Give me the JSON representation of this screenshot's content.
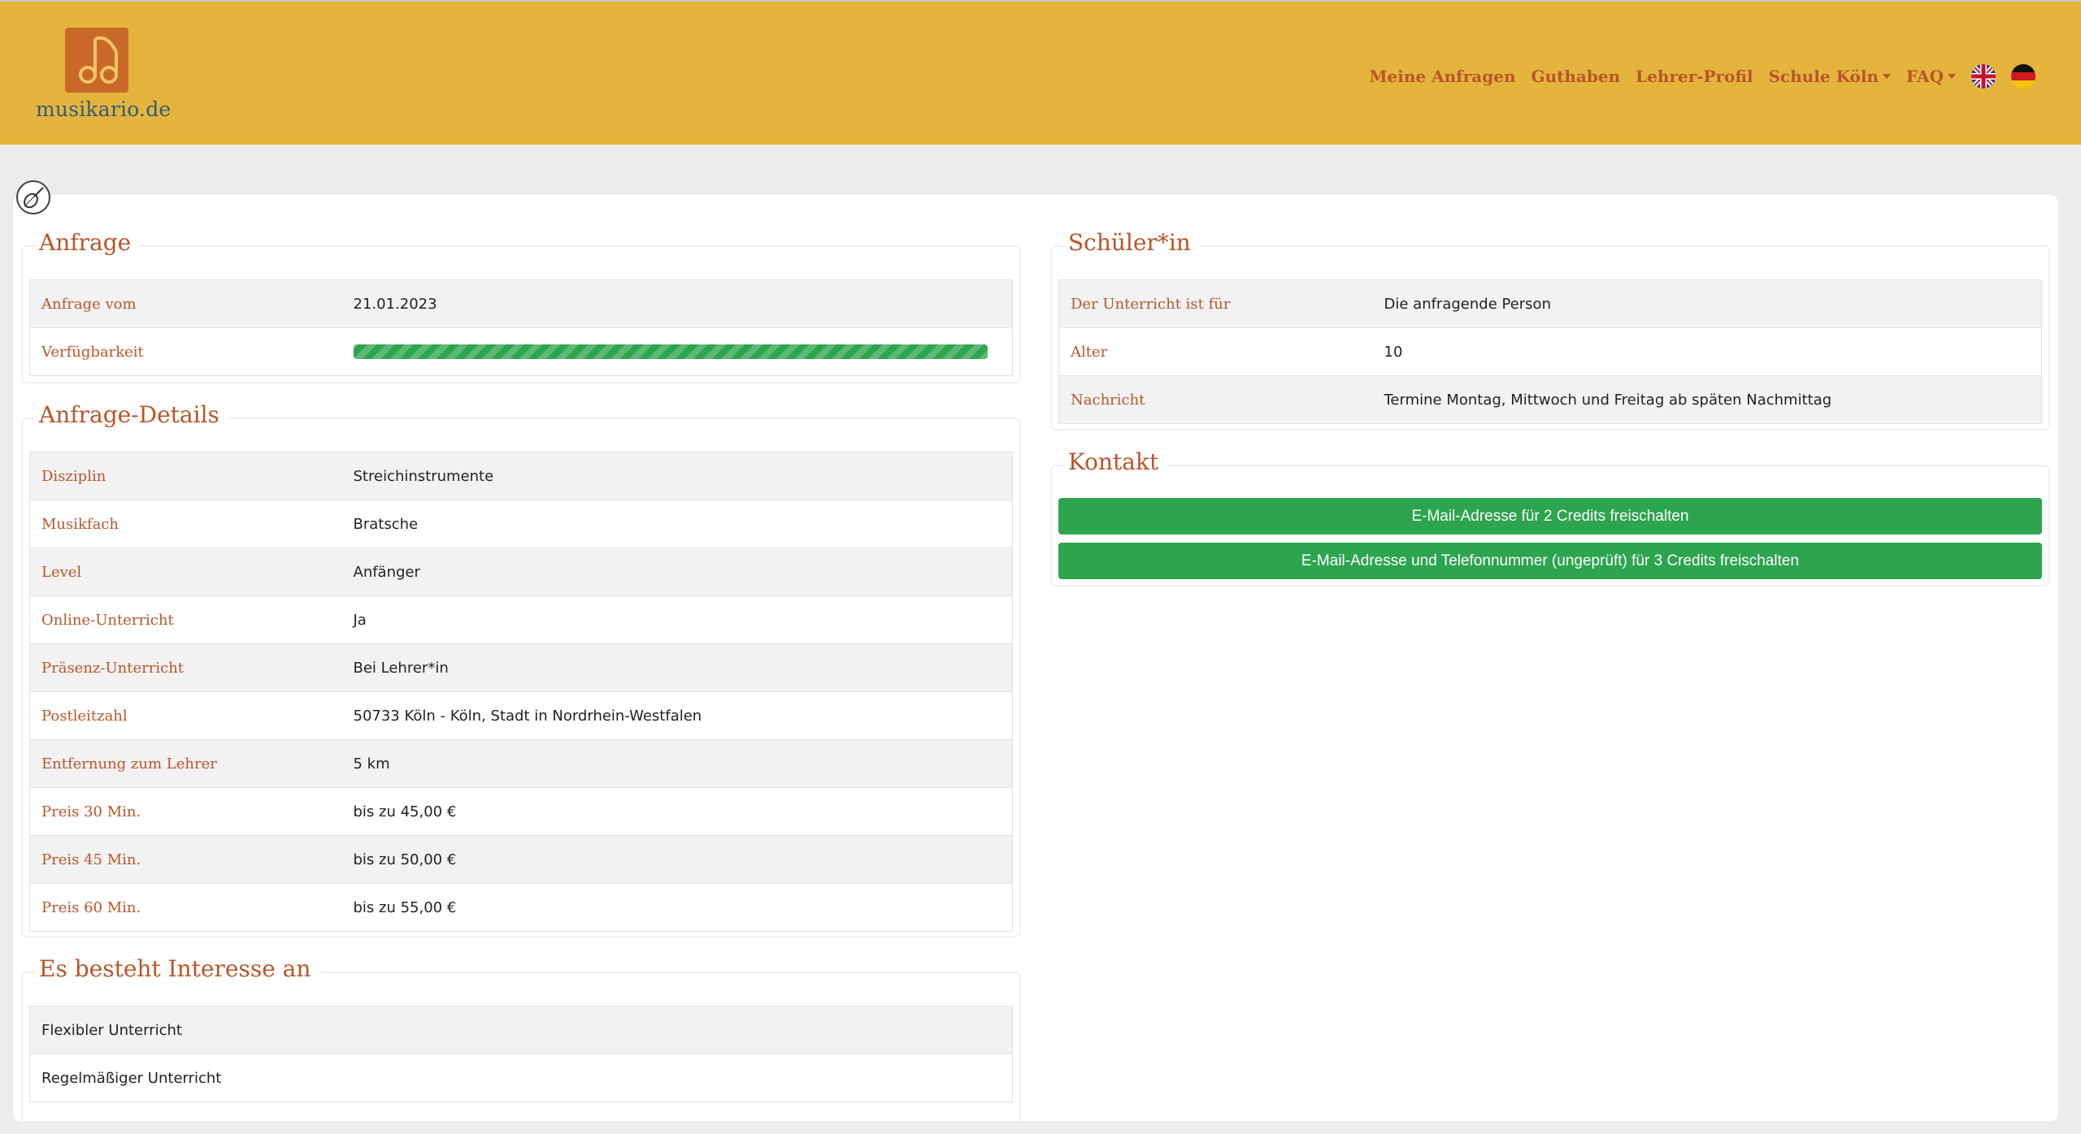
{
  "brand": {
    "name": "musikario.de"
  },
  "nav": {
    "items": [
      "Meine Anfragen",
      "Guthaben",
      "Lehrer-Profil"
    ],
    "school_dropdown": "Schule Köln",
    "faq_dropdown": "FAQ",
    "languages": [
      "english-flag-icon",
      "german-flag-icon"
    ]
  },
  "anfrage": {
    "title": "Anfrage",
    "rows": [
      {
        "label": "Anfrage vom",
        "value": "21.01.2023"
      },
      {
        "label": "Verfügbarkeit",
        "progress": 1.0
      }
    ]
  },
  "details": {
    "title": "Anfrage-Details",
    "rows": [
      {
        "label": "Disziplin",
        "value": "Streichinstrumente"
      },
      {
        "label": "Musikfach",
        "value": "Bratsche"
      },
      {
        "label": "Level",
        "value": "Anfänger"
      },
      {
        "label": "Online-Unterricht",
        "value": "Ja"
      },
      {
        "label": "Präsenz-Unterricht",
        "value": "Bei Lehrer*in"
      },
      {
        "label": "Postleitzahl",
        "value": "50733 Köln - Köln, Stadt in Nordrhein-Westfalen"
      },
      {
        "label": "Entfernung zum Lehrer",
        "value": "5 km"
      },
      {
        "label": "Preis 30 Min.",
        "value": "bis zu 45,00 €"
      },
      {
        "label": "Preis 45 Min.",
        "value": "bis zu 50,00 €"
      },
      {
        "label": "Preis 60 Min.",
        "value": "bis zu 55,00 €"
      }
    ]
  },
  "interesse": {
    "title": "Es besteht Interesse an",
    "items": [
      "Flexibler Unterricht",
      "Regelmäßiger Unterricht"
    ]
  },
  "schueler": {
    "title": "Schüler*in",
    "rows": [
      {
        "label": "Der Unterricht ist für",
        "value": "Die anfragende Person"
      },
      {
        "label": "Alter",
        "value": "10"
      },
      {
        "label": "Nachricht",
        "value": "Termine Montag, Mittwoch und Freitag ab späten Nachmittag"
      }
    ]
  },
  "kontakt": {
    "title": "Kontakt",
    "buttons": [
      "E-Mail-Adresse für 2 Credits freischalten",
      "E-Mail-Adresse und Telefonnummer (ungeprüft) für 3 Credits freischalten"
    ]
  },
  "colors": {
    "header": "#e5b43c",
    "accent": "#b9552a",
    "button": "#2da44e",
    "logo": "#c8692a"
  }
}
